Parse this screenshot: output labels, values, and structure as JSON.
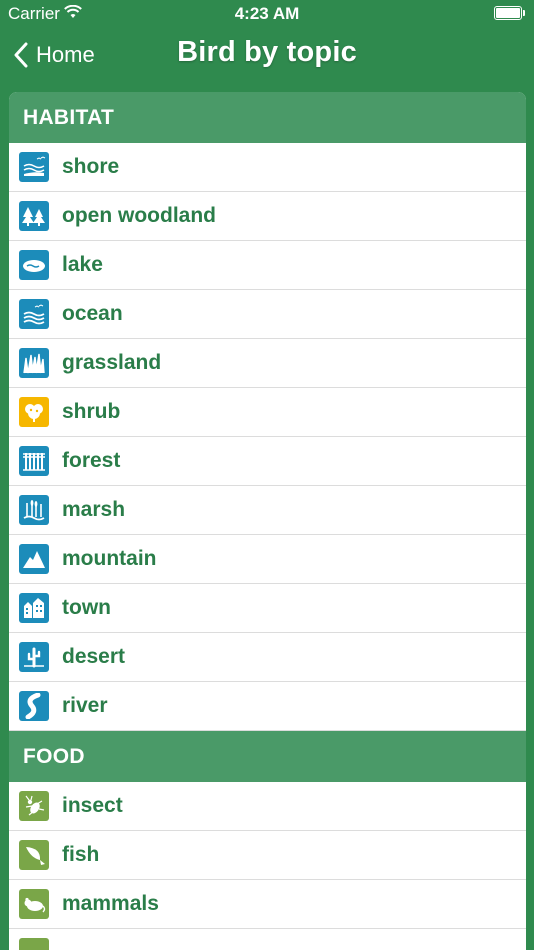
{
  "status": {
    "carrier": "Carrier",
    "time": "4:23 AM"
  },
  "nav": {
    "back_label": "Home",
    "title": "Bird by topic"
  },
  "sections": [
    {
      "header": "HABITAT",
      "items": [
        {
          "label": "shore",
          "icon": "shore-icon",
          "color": "#1c8cba"
        },
        {
          "label": "open woodland",
          "icon": "open-woodland-icon",
          "color": "#1c8cba"
        },
        {
          "label": "lake",
          "icon": "lake-icon",
          "color": "#1c8cba"
        },
        {
          "label": "ocean",
          "icon": "ocean-icon",
          "color": "#1c8cba"
        },
        {
          "label": "grassland",
          "icon": "grassland-icon",
          "color": "#1c8cba"
        },
        {
          "label": "shrub",
          "icon": "shrub-icon",
          "color": "#f6b700"
        },
        {
          "label": "forest",
          "icon": "forest-icon",
          "color": "#1c8cba"
        },
        {
          "label": "marsh",
          "icon": "marsh-icon",
          "color": "#1c8cba"
        },
        {
          "label": "mountain",
          "icon": "mountain-icon",
          "color": "#1c8cba"
        },
        {
          "label": "town",
          "icon": "town-icon",
          "color": "#1c8cba"
        },
        {
          "label": "desert",
          "icon": "desert-icon",
          "color": "#1c8cba"
        },
        {
          "label": "river",
          "icon": "river-icon",
          "color": "#1c8cba"
        }
      ]
    },
    {
      "header": "FOOD",
      "items": [
        {
          "label": "insect",
          "icon": "insect-icon",
          "color": "#7aa648"
        },
        {
          "label": "fish",
          "icon": "fish-icon",
          "color": "#7aa648"
        },
        {
          "label": "mammals",
          "icon": "mammals-icon",
          "color": "#7aa648"
        }
      ]
    }
  ],
  "colors": {
    "brand_green": "#2f8a4e",
    "section_green": "#4a9a68",
    "label_green": "#2a7d49"
  }
}
